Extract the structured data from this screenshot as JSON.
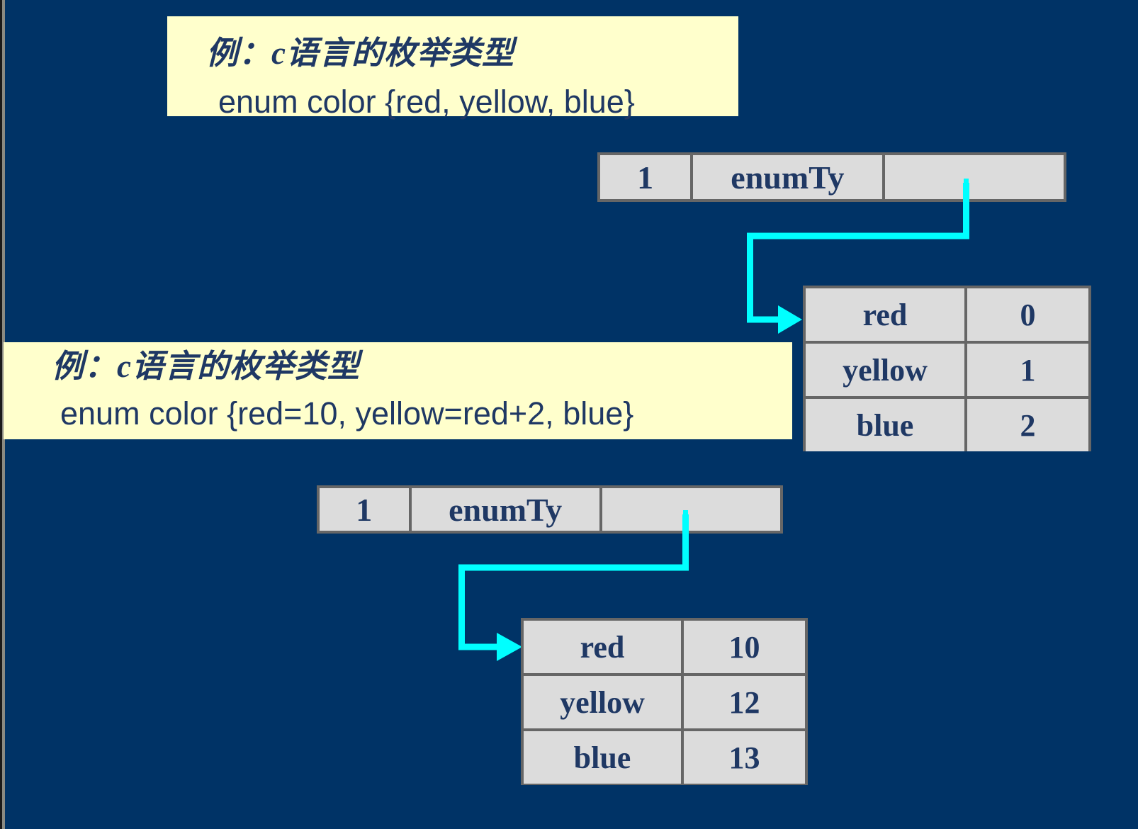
{
  "slide": {
    "background_color": "#003366",
    "accent_color": "#00ffff",
    "callout_bg_color": "#ffffcc",
    "text_color": "#1f3864",
    "cell_bg_color": "#dcdcdc",
    "cell_border_color": "#666666"
  },
  "examples": [
    {
      "label": "例：c语言的枚举类型",
      "code": "enum color {red, yellow, blue}",
      "descriptor": {
        "cells": [
          "1",
          "enumTy",
          ""
        ]
      },
      "values": {
        "rows": [
          {
            "name": "red",
            "value": "0"
          },
          {
            "name": "yellow",
            "value": "1"
          },
          {
            "name": "blue",
            "value": "2"
          }
        ]
      }
    },
    {
      "label": "例：c语言的枚举类型",
      "code": "enum color {red=10, yellow=red+2, blue}",
      "descriptor": {
        "cells": [
          "1",
          "enumTy",
          ""
        ]
      },
      "values": {
        "rows": [
          {
            "name": "red",
            "value": "10"
          },
          {
            "name": "yellow",
            "value": "12"
          },
          {
            "name": "blue",
            "value": "13"
          }
        ]
      }
    }
  ]
}
